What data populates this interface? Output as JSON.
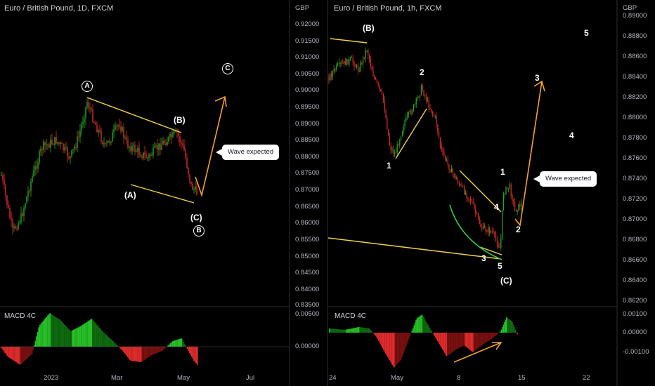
{
  "left_chart": {
    "title": "Euro / British Pound, 1D, FXCM",
    "price_unit": "GBP",
    "y_ticks": [
      "0.92000",
      "0.91500",
      "0.91000",
      "0.90500",
      "0.90000",
      "0.89500",
      "0.89000",
      "0.88500",
      "0.88000",
      "0.87500",
      "0.87000",
      "0.86500",
      "0.86000",
      "0.85500",
      "0.85000",
      "0.84500",
      "0.84000",
      "0.83500"
    ],
    "x_ticks": [
      "2023",
      "Mar",
      "May",
      "Jul"
    ],
    "indicator_label": "MACD 4C",
    "macd_ticks": [
      "0.00500",
      "0.00000"
    ],
    "callout": "Wave expected",
    "wave_labels": {
      "A": "A",
      "B_paren": "(B)",
      "A_paren": "(A)",
      "C_paren": "(C)",
      "B_circle": "B",
      "C_circle": "C"
    }
  },
  "right_chart": {
    "title": "Euro / British Pound, 1h, FXCM",
    "price_unit": "GBP",
    "y_ticks": [
      "0.89000",
      "0.88800",
      "0.88600",
      "0.88400",
      "0.88200",
      "0.88000",
      "0.87800",
      "0.87600",
      "0.87400",
      "0.87200",
      "0.87000",
      "0.86800",
      "0.86600",
      "0.86400",
      "0.86200"
    ],
    "x_ticks": [
      "24",
      "May",
      "8",
      "15",
      "22"
    ],
    "indicator_label": "MACD 4C",
    "macd_ticks": [
      "0.00100",
      "0.00000",
      "-0.00100"
    ],
    "callout": "Wave expected",
    "wave_labels": {
      "B_paren": "(B)",
      "w2": "2",
      "w1": "1",
      "w3": "3",
      "w4": "4",
      "w5": "5",
      "C_paren": "(C)",
      "sub1": "1",
      "sub2": "2",
      "sub3": "3",
      "sub4": "4",
      "sub5": "5"
    }
  },
  "colors": {
    "up": "#22ab22",
    "down": "#e02b2b",
    "trendline": "#f0d24a",
    "projection": "#f5a030",
    "curve": "#2ecc40",
    "background": "#000000"
  }
}
